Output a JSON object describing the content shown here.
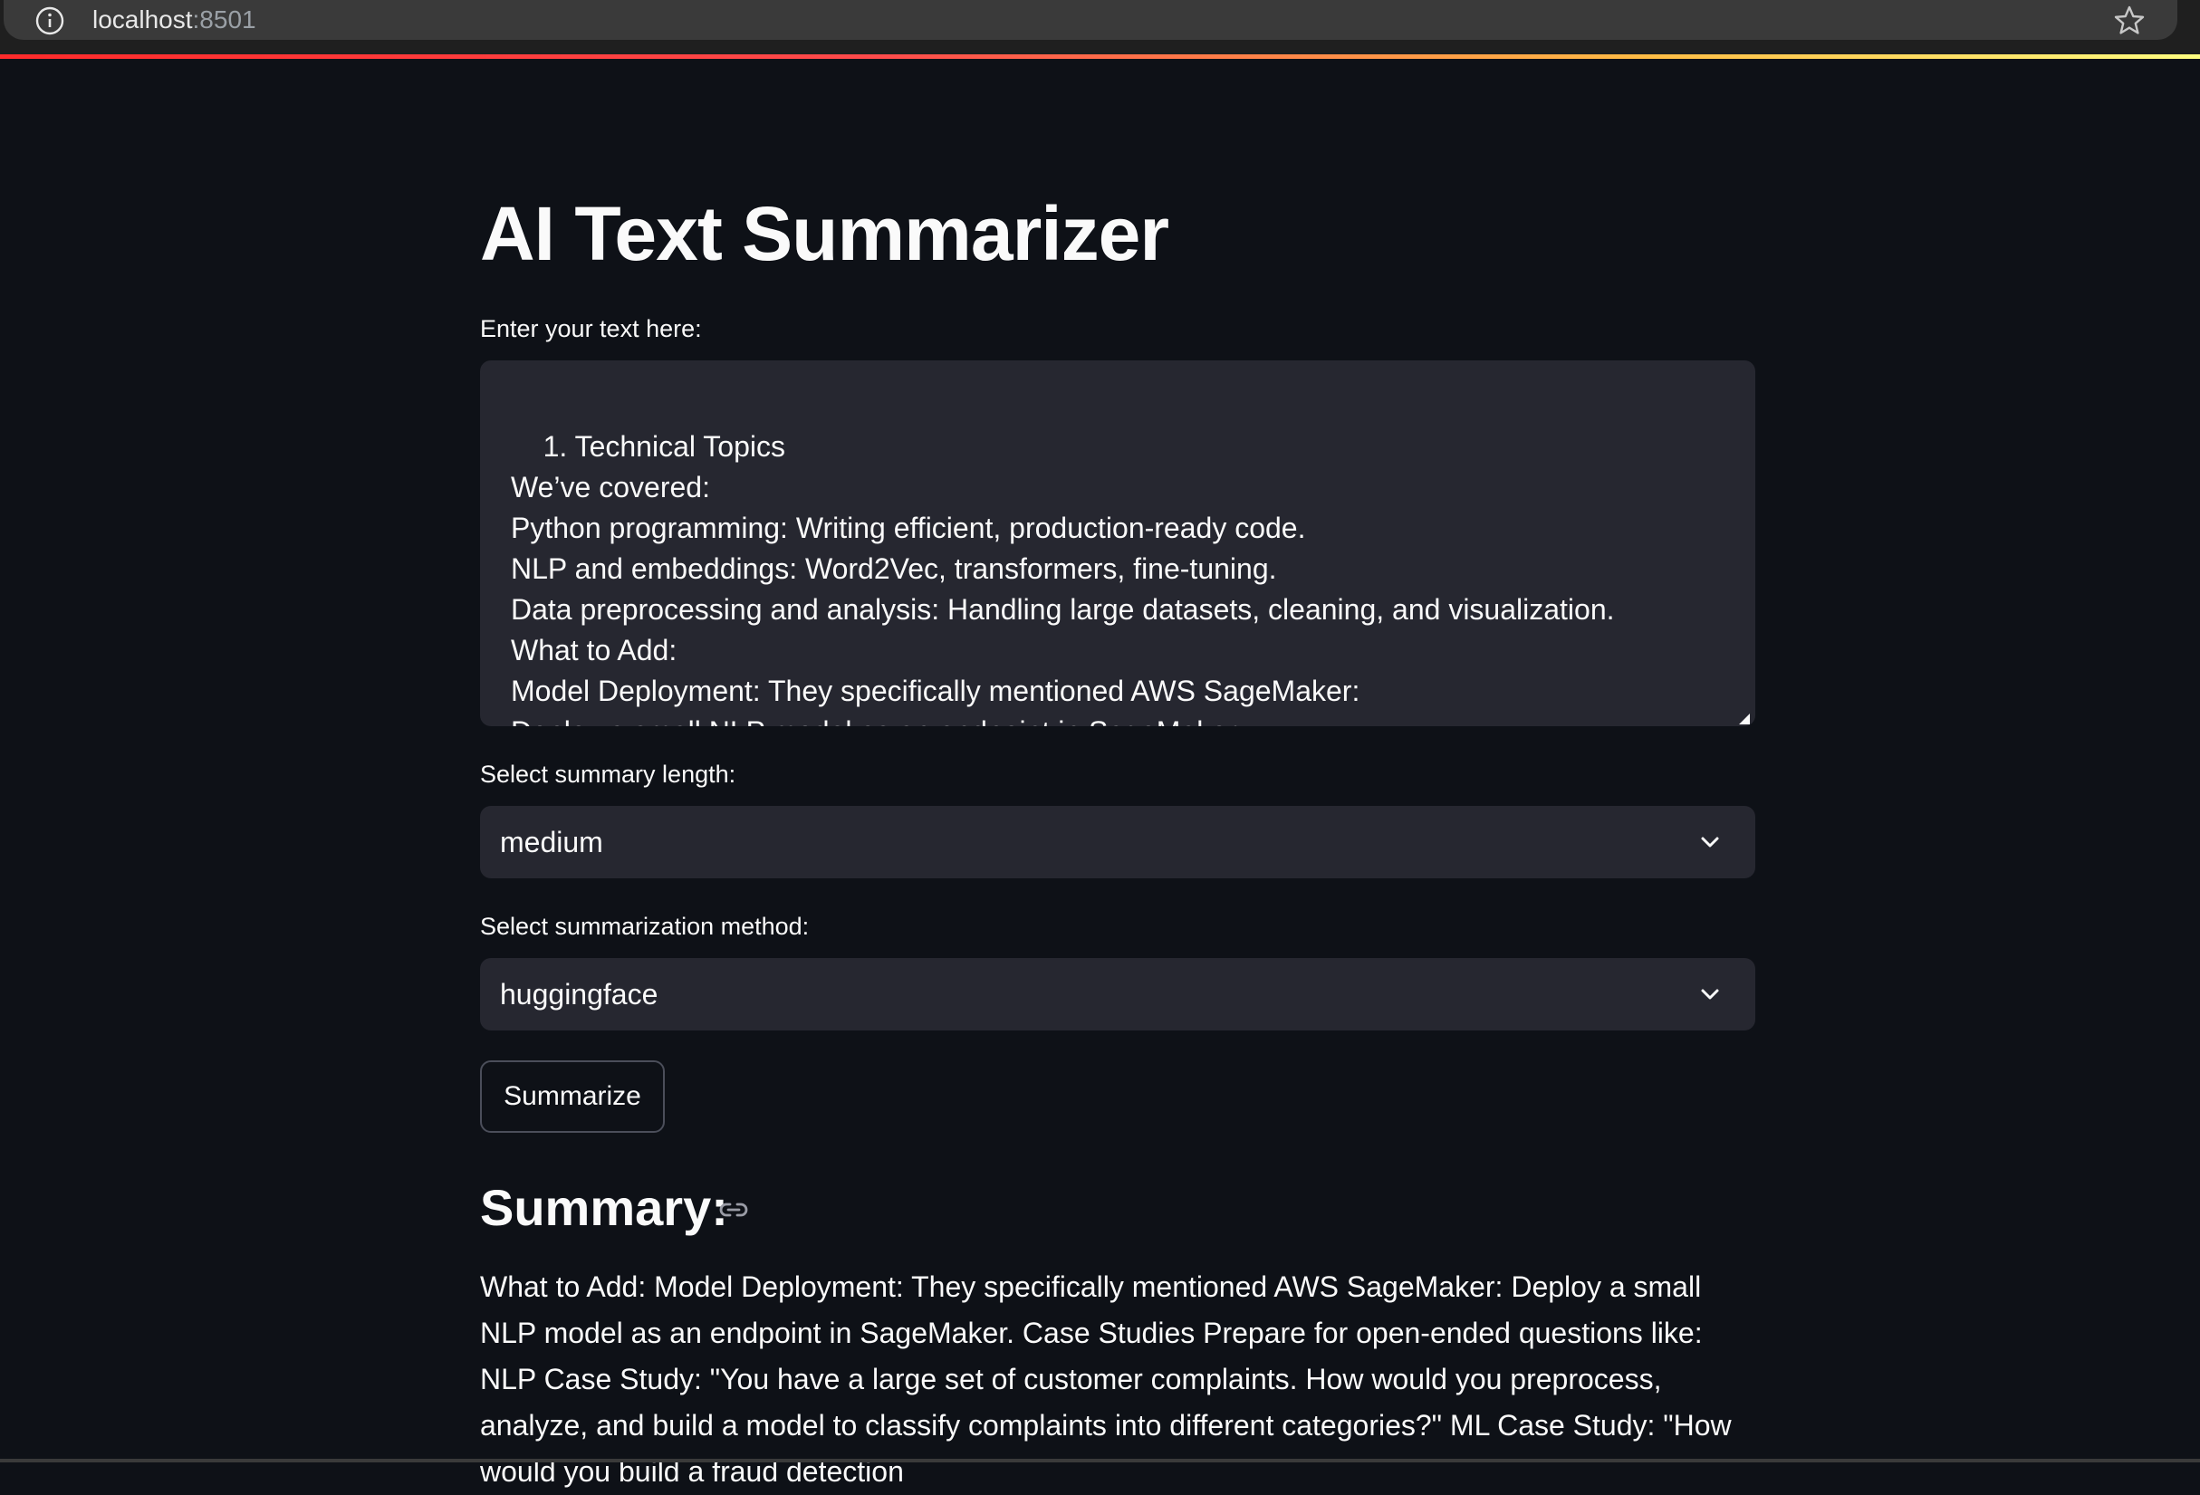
{
  "browser": {
    "host": "localhost",
    "port": ":8501",
    "icons": [
      "info-icon",
      "star-icon"
    ]
  },
  "app": {
    "title": "AI Text Summarizer",
    "input_label": "Enter your text here:",
    "input_value": "1. Technical Topics\nWe’ve covered:\nPython programming: Writing efficient, production-ready code.\nNLP and embeddings: Word2Vec, transformers, fine-tuning.\nData preprocessing and analysis: Handling large datasets, cleaning, and visualization.\nWhat to Add:\nModel Deployment: They specifically mentioned AWS SageMaker:\nDeploy a small NLP model as an endpoint in SageMaker.",
    "length_label": "Select summary length:",
    "length_value": "medium",
    "method_label": "Select summarization method:",
    "method_value": "huggingface",
    "summarize_button": "Summarize",
    "summary_heading": "Summary:",
    "summary_text": "What to Add: Model Deployment: They specifically mentioned AWS SageMaker: Deploy a small NLP model as an endpoint in SageMaker. Case Studies Prepare for open-ended questions like: NLP Case Study: \"You have a large set of customer complaints. How would you preprocess, analyze, and build a model to classify complaints into different categories?\" ML Case Study: \"How would you build a fraud detection"
  },
  "colors": {
    "background": "#0e1117",
    "widget_background": "#262730",
    "text": "#fafafa",
    "button_border": "#4b4e5a",
    "accent_red": "#ff4b4b"
  }
}
